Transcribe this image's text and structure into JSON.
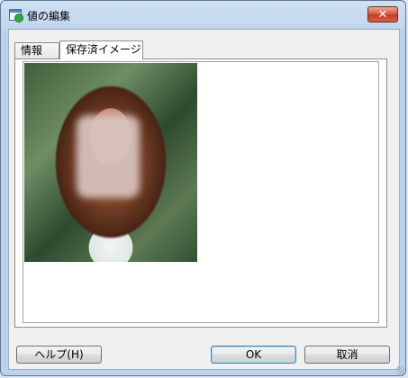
{
  "window": {
    "title": "値の編集",
    "close_glyph": "✕"
  },
  "tabs": [
    {
      "label": "情報"
    },
    {
      "label": "保存済イメージ"
    }
  ],
  "buttons": {
    "help": "ヘルプ(H)",
    "ok": "OK",
    "cancel": "取消"
  }
}
